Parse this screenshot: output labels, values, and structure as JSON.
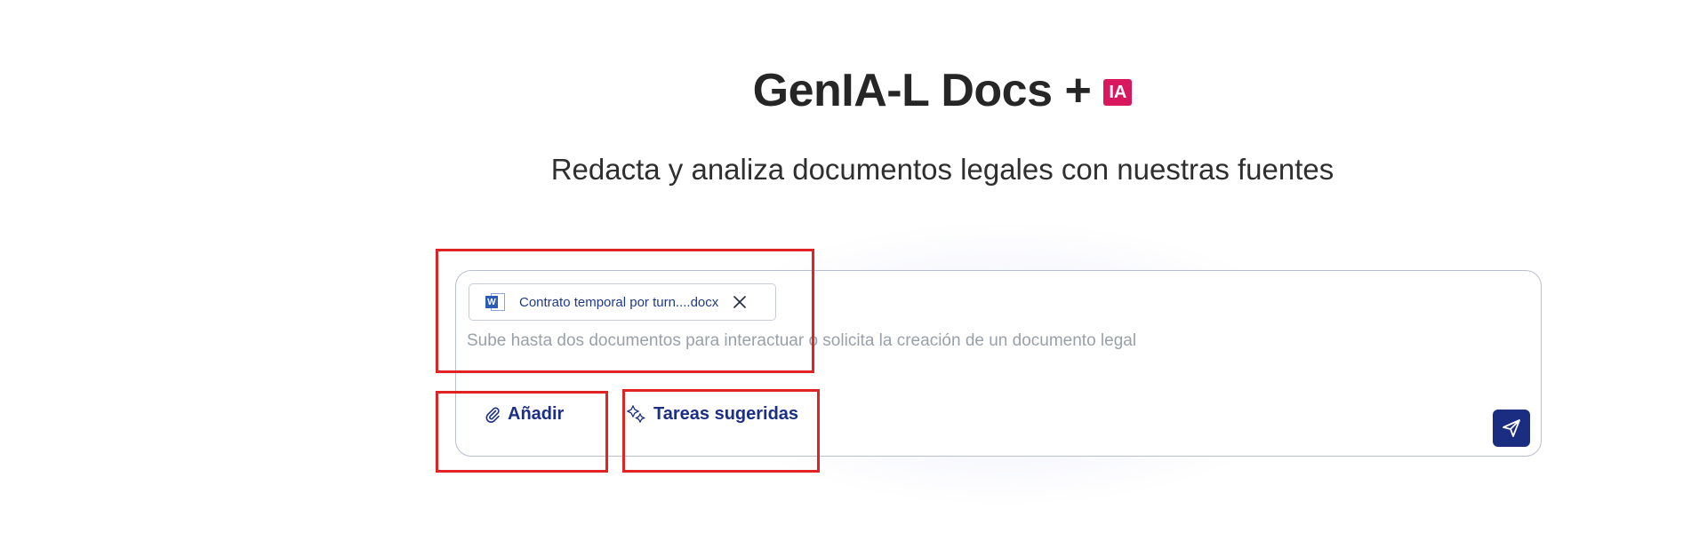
{
  "header": {
    "title": "GenIA-L Docs +",
    "badge": "IA",
    "subtitle": "Redacta y analiza documentos legales con nuestras fuentes"
  },
  "composer": {
    "attachment": {
      "icon": "word-file-icon",
      "icon_letter": "W",
      "file_name": "Contrato temporal por turn....docx"
    },
    "placeholder": "Sube hasta dos documentos para interactuar o solicita la creación de un documento legal",
    "add_label": "Añadir",
    "tasks_label": "Tareas sugeridas"
  },
  "colors": {
    "brand_navy": "#1b2d80",
    "badge_pink": "#d8175f",
    "highlight_red": "#e02424"
  }
}
